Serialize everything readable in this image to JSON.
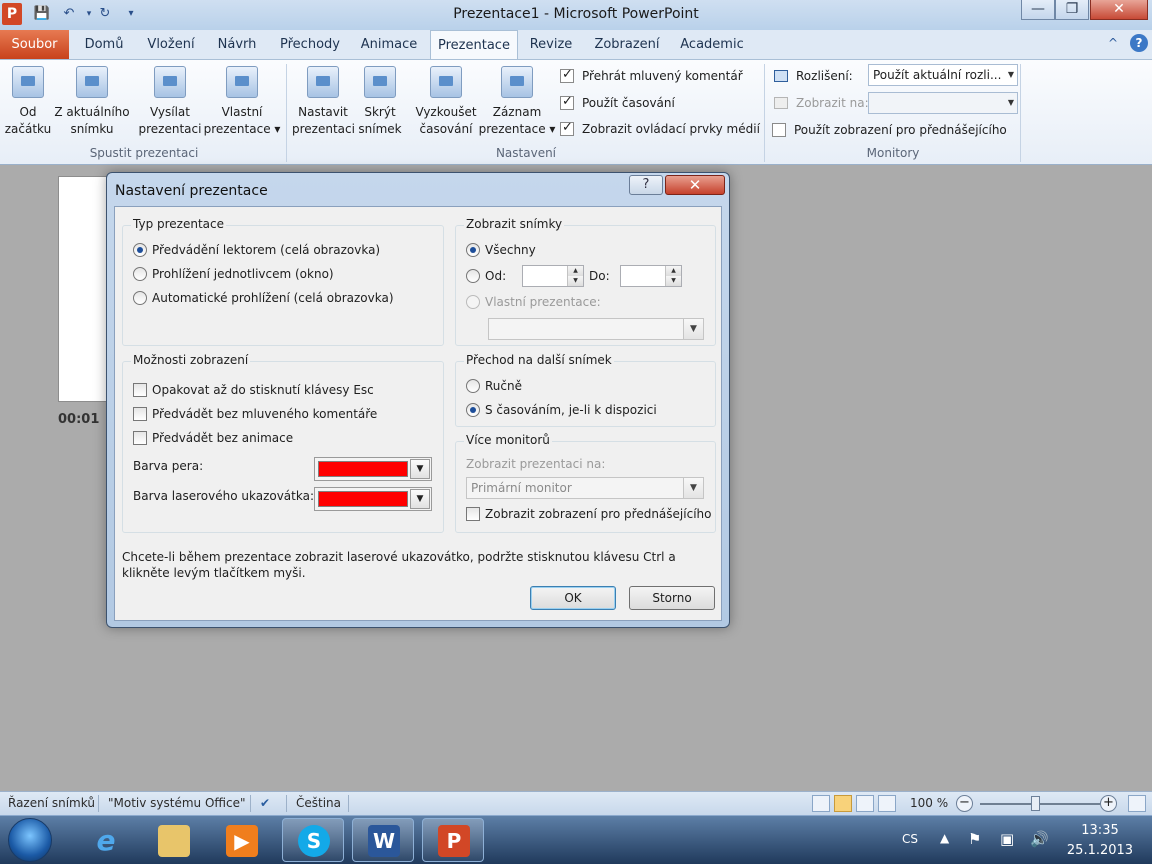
{
  "window": {
    "title": "Prezentace1 - Microsoft PowerPoint",
    "logo_letter": "P",
    "minimize": "—",
    "maximize": "❐",
    "close": "✕"
  },
  "qat": {
    "save": "💾",
    "undo": "↶",
    "redo": "↻",
    "customize": "▾"
  },
  "tabs": [
    {
      "label": "Soubor"
    },
    {
      "label": "Domů"
    },
    {
      "label": "Vložení"
    },
    {
      "label": "Návrh"
    },
    {
      "label": "Přechody"
    },
    {
      "label": "Animace"
    },
    {
      "label": "Prezentace"
    },
    {
      "label": "Revize"
    },
    {
      "label": "Zobrazení"
    },
    {
      "label": "Academic"
    }
  ],
  "ribbon_help": "?",
  "ribbon_collapse": "^",
  "ribbon": {
    "start_group": {
      "label": "Spustit prezentaci",
      "buttons": [
        {
          "label": "Od\nzačátku"
        },
        {
          "label": "Z aktuálního\nsnímku"
        },
        {
          "label": "Vysílat\nprezentaci"
        },
        {
          "label": "Vlastní\nprezentace ▾"
        }
      ]
    },
    "setup_group": {
      "label": "Nastavení",
      "buttons": [
        {
          "label": "Nastavit\nprezentaci"
        },
        {
          "label": "Skrýt\nsnímek"
        },
        {
          "label": "Vyzkoušet\nčasování"
        },
        {
          "label": "Záznam\nprezentace ▾"
        }
      ],
      "checks": [
        {
          "label": "Přehrát mluvený komentář",
          "checked": true
        },
        {
          "label": "Použít časování",
          "checked": true
        },
        {
          "label": "Zobrazit ovládací prvky médií",
          "checked": true
        }
      ]
    },
    "monitors_group": {
      "label": "Monitory",
      "resolution_label": "Rozlišení:",
      "resolution_value": "Použít aktuální rozli...",
      "show_on_label": "Zobrazit na:",
      "show_on_value": "",
      "presenter_view_label": "Použít zobrazení pro přednášejícího"
    }
  },
  "slide_timing": "00:01",
  "dialog": {
    "title": "Nastavení prezentace",
    "help": "?",
    "close": "✕",
    "show_type": {
      "title": "Typ prezentace",
      "options": [
        {
          "label": "Předvádění lektorem (celá obrazovka)",
          "selected": true
        },
        {
          "label": "Prohlížení jednotlivcem (okno)",
          "selected": false
        },
        {
          "label": "Automatické prohlížení (celá obrazovka)",
          "selected": false
        }
      ]
    },
    "show_slides": {
      "title": "Zobrazit snímky",
      "all_label": "Všechny",
      "from_label": "Od:",
      "from_value": "",
      "to_label": "Do:",
      "to_value": "",
      "custom_label": "Vlastní prezentace:",
      "custom_value": ""
    },
    "show_options": {
      "title": "Možnosti zobrazení",
      "checks": [
        {
          "label": "Opakovat až do stisknutí klávesy Esc",
          "checked": false
        },
        {
          "label": "Předvádět bez mluveného komentáře",
          "checked": false
        },
        {
          "label": "Předvádět bez animace",
          "checked": false
        }
      ],
      "pen_color_label": "Barva pera:",
      "pen_color": "#ff0000",
      "laser_color_label": "Barva laserového ukazovátka:",
      "laser_color": "#ff0000"
    },
    "advance": {
      "title": "Přechod na další snímek",
      "manual_label": "Ručně",
      "timings_label": "S časováním, je-li k dispozici"
    },
    "monitors": {
      "title": "Více monitorů",
      "display_on_label": "Zobrazit prezentaci na:",
      "display_on_value": "Primární monitor",
      "presenter_view_label": "Zobrazit zobrazení pro přednášejícího"
    },
    "hint": "Chcete-li během prezentace zobrazit laserové ukazovátko, podržte stisknutou klávesu Ctrl a klikněte levým tlačítkem myši.",
    "ok_label": "OK",
    "cancel_label": "Storno"
  },
  "statusbar": {
    "sorter": "Řazení snímků",
    "theme": "\"Motiv systému Office\"",
    "language": "Čeština",
    "zoom": "100 %",
    "zoom_minus": "−",
    "zoom_plus": "+"
  },
  "taskbar": {
    "lang": "CS",
    "time": "13:35",
    "date": "25.1.2013"
  }
}
